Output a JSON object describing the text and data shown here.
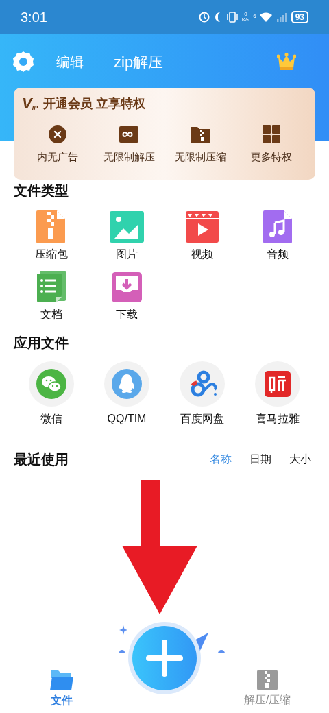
{
  "status_bar": {
    "time": "3:01",
    "net_speed": "0",
    "net_unit": "K/s",
    "wifi_label": "6",
    "battery": "93"
  },
  "header": {
    "edit": "编辑",
    "title": "zip解压"
  },
  "vip_card": {
    "logo_main": "V",
    "logo_sub": "IP",
    "headline": "开通会员 立享特权",
    "perks": [
      {
        "kind": "no-ads",
        "label": "内无广告"
      },
      {
        "kind": "unlimited",
        "label": "无限制解压"
      },
      {
        "kind": "zip",
        "label": "无限制压缩"
      },
      {
        "kind": "more",
        "label": "更多特权"
      }
    ]
  },
  "file_types": {
    "title": "文件类型",
    "items": [
      {
        "kind": "archive",
        "label": "压缩包"
      },
      {
        "kind": "image",
        "label": "图片"
      },
      {
        "kind": "video",
        "label": "视频"
      },
      {
        "kind": "audio",
        "label": "音频"
      },
      {
        "kind": "document",
        "label": "文档"
      },
      {
        "kind": "download",
        "label": "下载"
      }
    ]
  },
  "app_files": {
    "title": "应用文件",
    "items": [
      {
        "kind": "wechat",
        "label": "微信"
      },
      {
        "kind": "qq",
        "label": "QQ/TIM"
      },
      {
        "kind": "cloud",
        "label": "百度网盘"
      },
      {
        "kind": "listen",
        "label": "喜马拉雅"
      }
    ]
  },
  "recent": {
    "title": "最近使用",
    "sort_tabs": [
      {
        "label": "名称",
        "selected": true
      },
      {
        "label": "日期",
        "selected": false
      },
      {
        "label": "大小",
        "selected": false
      }
    ]
  },
  "bottom_nav": [
    {
      "kind": "files",
      "label": "文件",
      "selected": true
    },
    {
      "kind": "zip",
      "label": "解压/压缩",
      "selected": false
    }
  ]
}
